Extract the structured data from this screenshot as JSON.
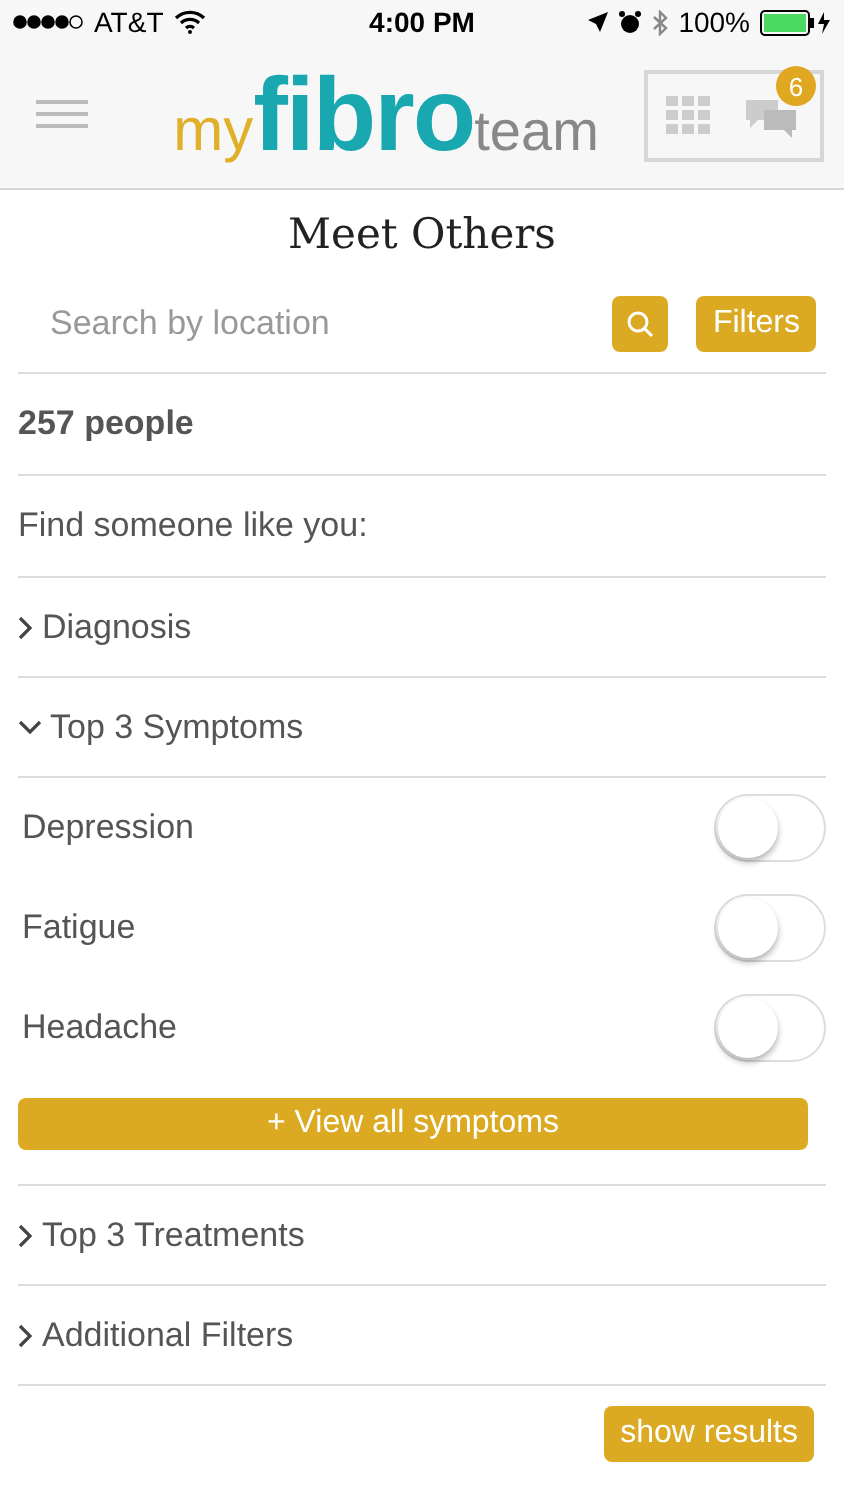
{
  "status_bar": {
    "carrier": "AT&T",
    "time": "4:00 PM",
    "battery": "100%"
  },
  "header": {
    "logo": {
      "prefix": "my",
      "main": "fibro",
      "suffix": "team"
    },
    "notification_count": "6"
  },
  "title": "Meet Others",
  "search": {
    "placeholder": "Search by location",
    "filters_button": "Filters"
  },
  "count": "257 people",
  "prompt": "Find someone like you:",
  "sections": [
    {
      "label": "Diagnosis",
      "expanded": false
    },
    {
      "label": "Top 3 Symptoms",
      "expanded": true,
      "options": [
        {
          "label": "Depression",
          "on": false
        },
        {
          "label": "Fatigue",
          "on": false
        },
        {
          "label": "Headache",
          "on": false
        }
      ],
      "more_button": "+ View all symptoms"
    },
    {
      "label": "Top 3 Treatments",
      "expanded": false
    },
    {
      "label": "Additional Filters",
      "expanded": false
    }
  ],
  "show_results": "show results"
}
